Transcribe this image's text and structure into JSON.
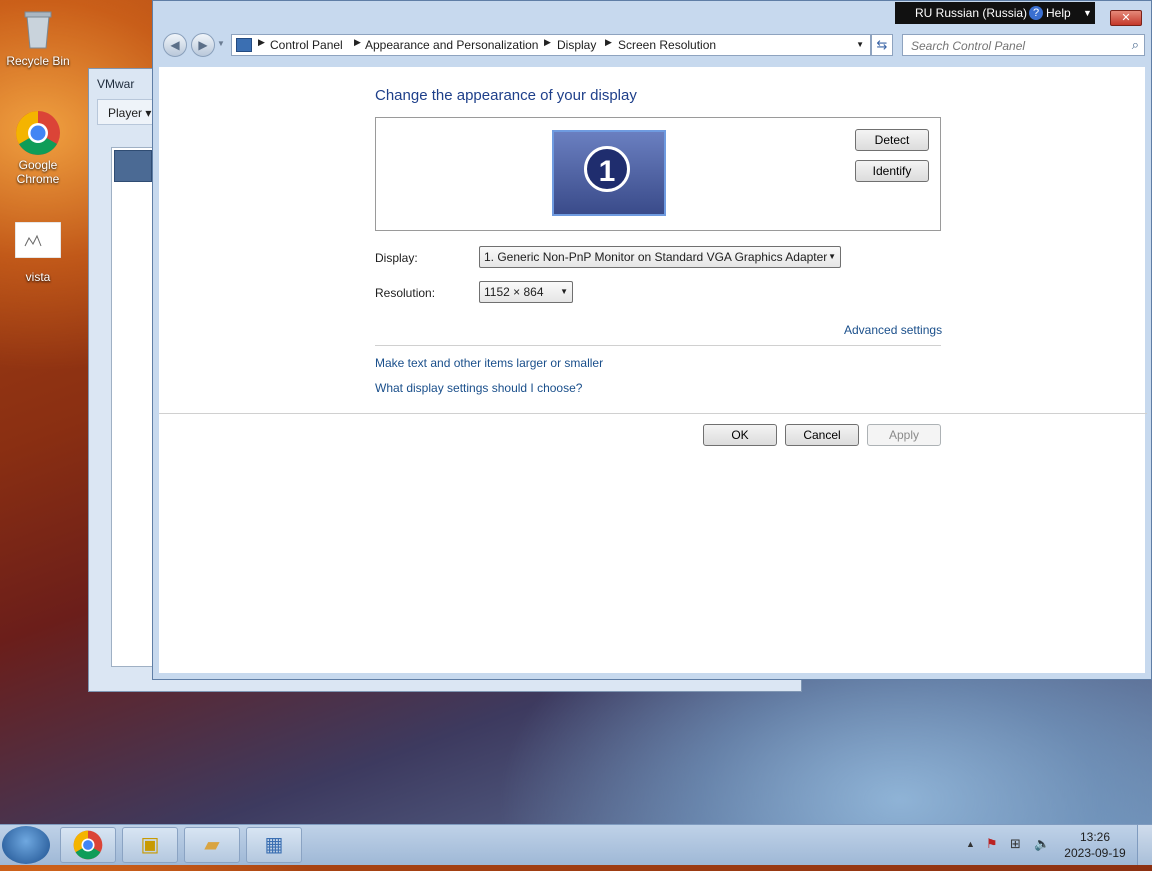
{
  "desktop": {
    "icons": [
      {
        "label": "Recycle Bin",
        "icon": "recycle-bin-icon"
      },
      {
        "label": "Google Chrome",
        "icon": "chrome-icon"
      },
      {
        "label": "vista",
        "icon": "image-file-icon"
      }
    ]
  },
  "vmware": {
    "title": "VMwar",
    "player_menu": "Player"
  },
  "language_bar": {
    "language": "RU Russian (Russia)",
    "help": "Help"
  },
  "window": {
    "breadcrumbs": [
      "Control Panel",
      "Appearance and Personalization",
      "Display",
      "Screen Resolution"
    ],
    "search_placeholder": "Search Control Panel",
    "heading": "Change the appearance of your display",
    "monitor_number": "1",
    "detect_label": "Detect",
    "identify_label": "Identify",
    "display_label": "Display:",
    "display_value": "1. Generic Non-PnP Monitor on Standard VGA Graphics Adapter",
    "resolution_label": "Resolution:",
    "resolution_value": "1152 × 864",
    "advanced_settings": "Advanced settings",
    "link_larger": "Make text and other items larger or smaller",
    "link_which": "What display settings should I choose?",
    "ok_label": "OK",
    "cancel_label": "Cancel",
    "apply_label": "Apply"
  },
  "taskbar": {
    "clock_time": "13:26",
    "clock_date": "2023-09-19"
  }
}
